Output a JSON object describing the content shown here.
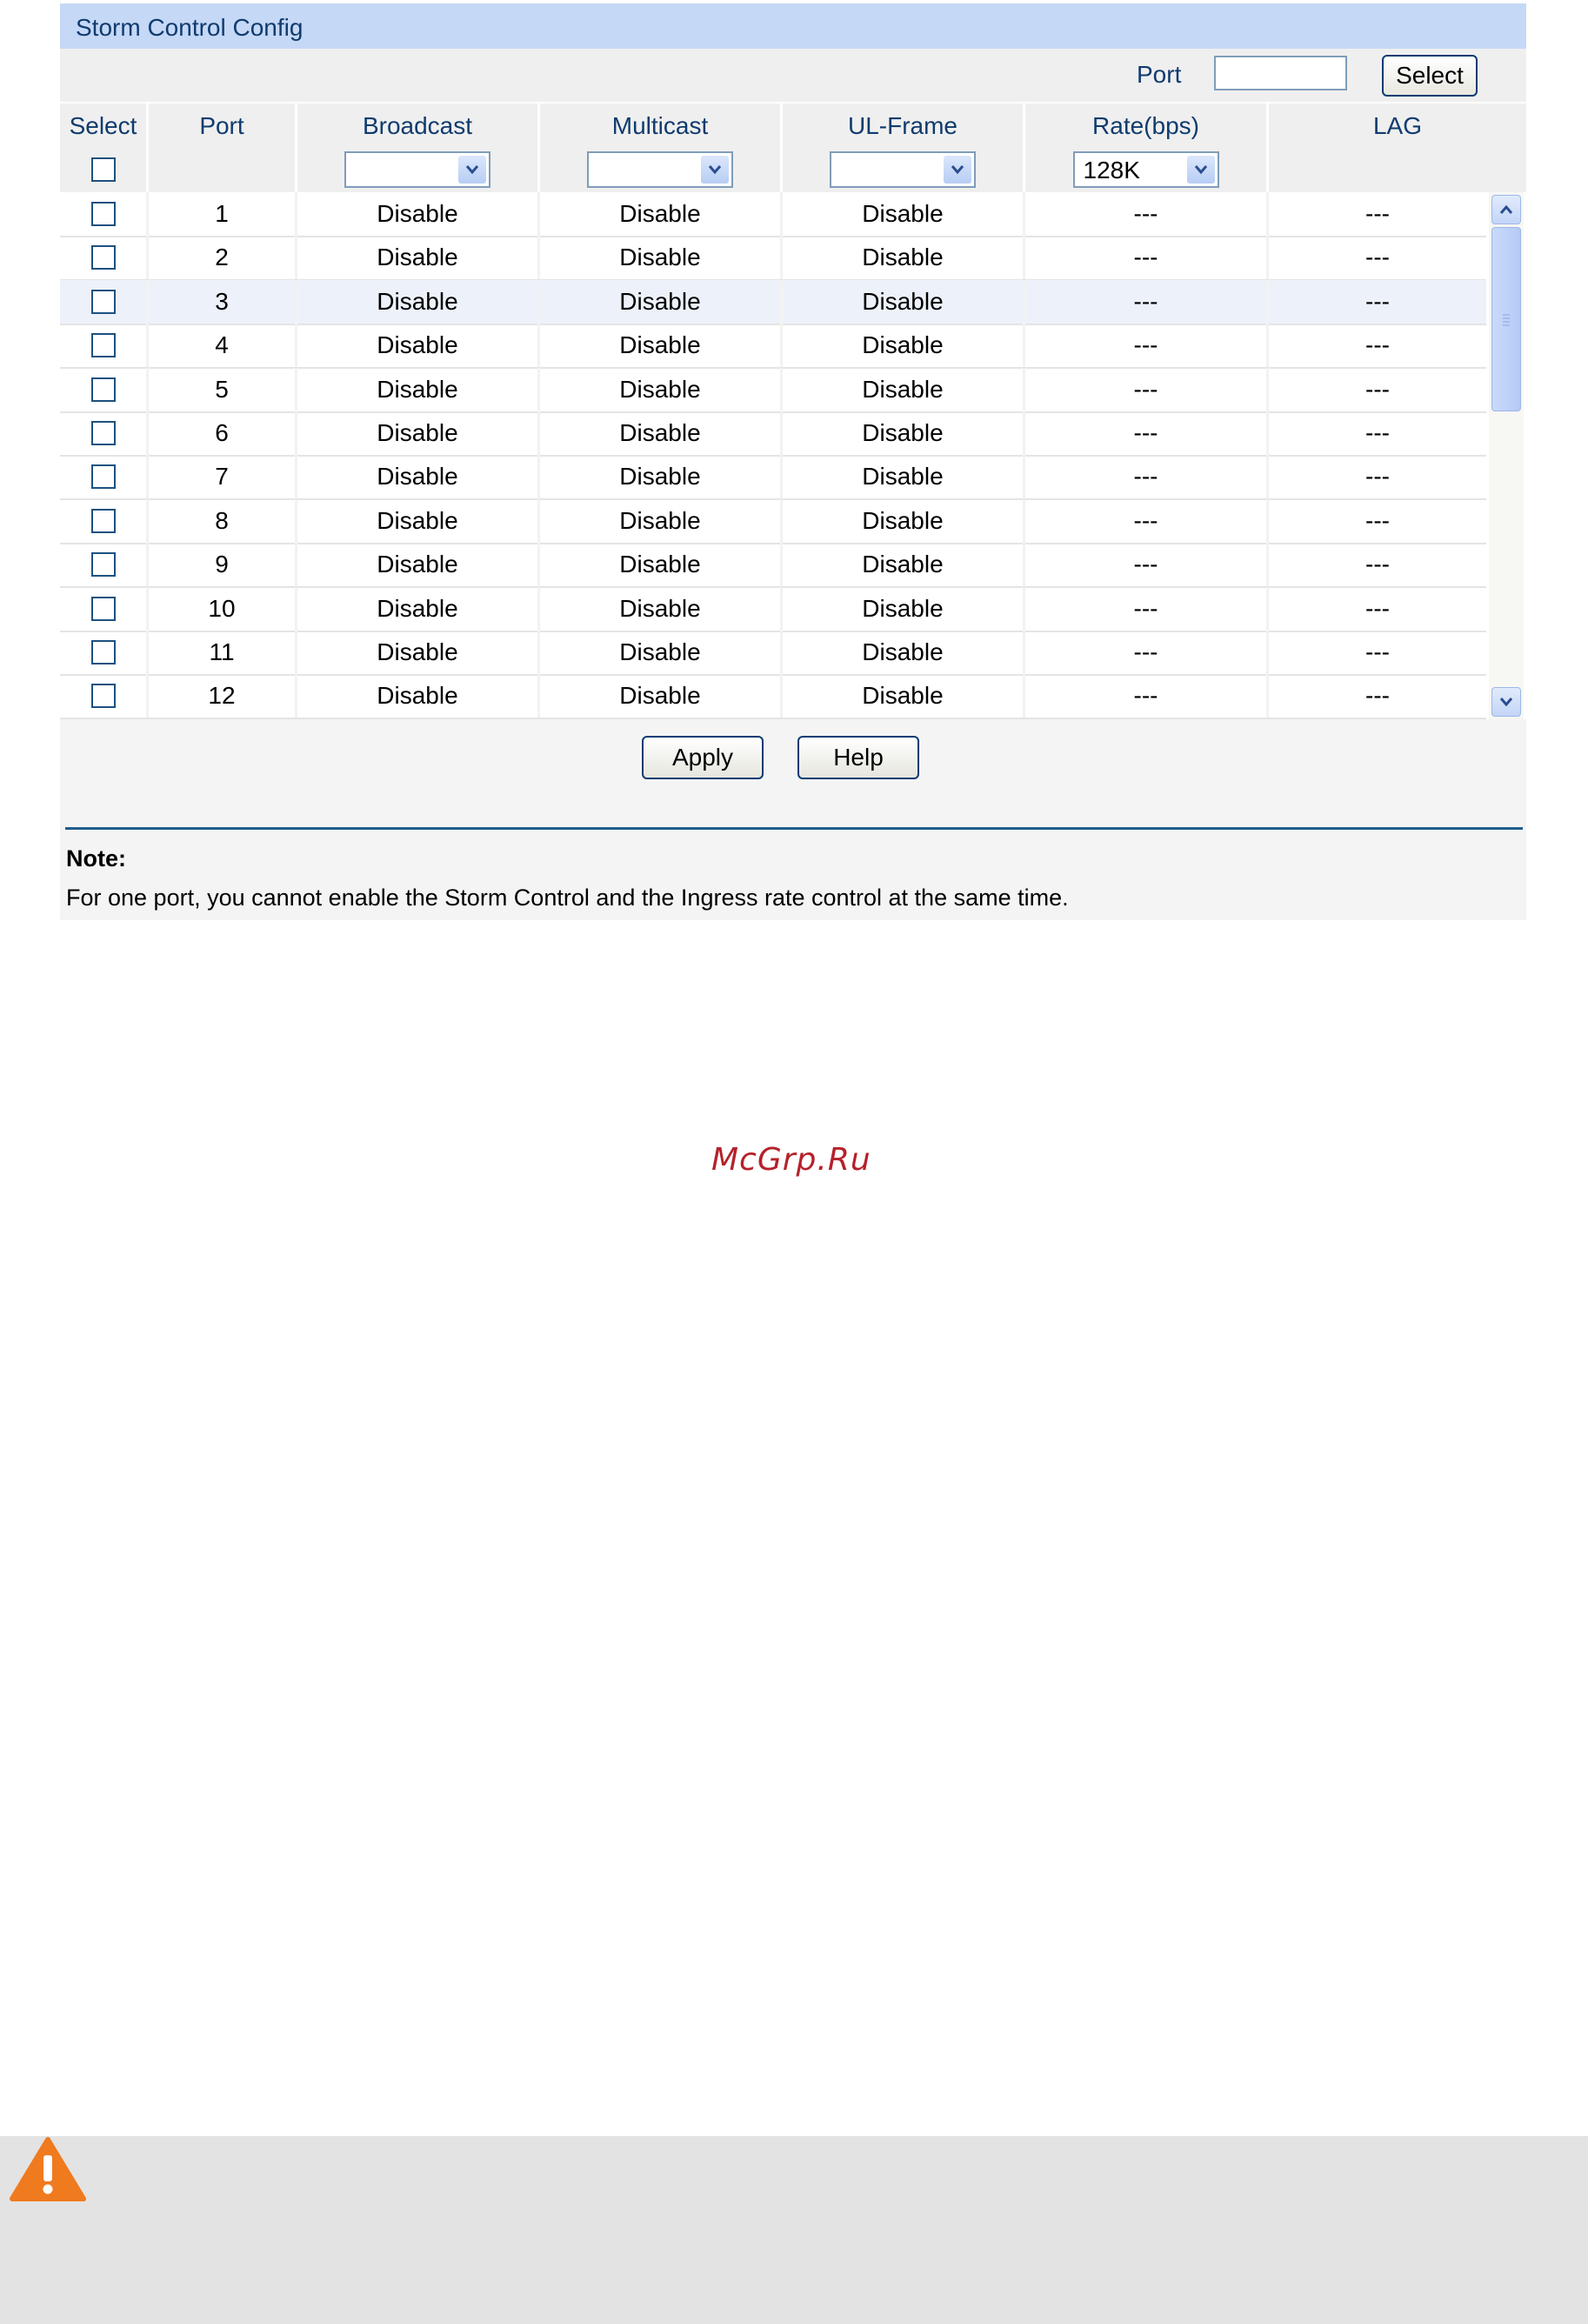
{
  "panel": {
    "title": "Storm Control Config",
    "port_label": "Port",
    "port_input_value": "",
    "select_button": "Select"
  },
  "columns": [
    "Select",
    "Port",
    "Broadcast",
    "Multicast",
    "UL-Frame",
    "Rate(bps)",
    "LAG"
  ],
  "controls": {
    "broadcast": "",
    "multicast": "",
    "ul_frame": "",
    "rate": "128K"
  },
  "rows": [
    {
      "port": "1",
      "broadcast": "Disable",
      "multicast": "Disable",
      "ul_frame": "Disable",
      "rate": "---",
      "lag": "---"
    },
    {
      "port": "2",
      "broadcast": "Disable",
      "multicast": "Disable",
      "ul_frame": "Disable",
      "rate": "---",
      "lag": "---"
    },
    {
      "port": "3",
      "broadcast": "Disable",
      "multicast": "Disable",
      "ul_frame": "Disable",
      "rate": "---",
      "lag": "---"
    },
    {
      "port": "4",
      "broadcast": "Disable",
      "multicast": "Disable",
      "ul_frame": "Disable",
      "rate": "---",
      "lag": "---"
    },
    {
      "port": "5",
      "broadcast": "Disable",
      "multicast": "Disable",
      "ul_frame": "Disable",
      "rate": "---",
      "lag": "---"
    },
    {
      "port": "6",
      "broadcast": "Disable",
      "multicast": "Disable",
      "ul_frame": "Disable",
      "rate": "---",
      "lag": "---"
    },
    {
      "port": "7",
      "broadcast": "Disable",
      "multicast": "Disable",
      "ul_frame": "Disable",
      "rate": "---",
      "lag": "---"
    },
    {
      "port": "8",
      "broadcast": "Disable",
      "multicast": "Disable",
      "ul_frame": "Disable",
      "rate": "---",
      "lag": "---"
    },
    {
      "port": "9",
      "broadcast": "Disable",
      "multicast": "Disable",
      "ul_frame": "Disable",
      "rate": "---",
      "lag": "---"
    },
    {
      "port": "10",
      "broadcast": "Disable",
      "multicast": "Disable",
      "ul_frame": "Disable",
      "rate": "---",
      "lag": "---"
    },
    {
      "port": "11",
      "broadcast": "Disable",
      "multicast": "Disable",
      "ul_frame": "Disable",
      "rate": "---",
      "lag": "---"
    },
    {
      "port": "12",
      "broadcast": "Disable",
      "multicast": "Disable",
      "ul_frame": "Disable",
      "rate": "---",
      "lag": "---"
    }
  ],
  "buttons": {
    "apply": "Apply",
    "help": "Help"
  },
  "note": {
    "title": "Note:",
    "text": "For one port, you cannot enable the Storm Control and the Ingress rate control at the same time."
  },
  "watermark": "McGrp.Ru",
  "colors": {
    "title_bar": "#c5d8f6",
    "header_text": "#0f3b6e",
    "divider": "#1f5c8b",
    "watermark": "#b5212a",
    "warning": "#f07a1e"
  }
}
